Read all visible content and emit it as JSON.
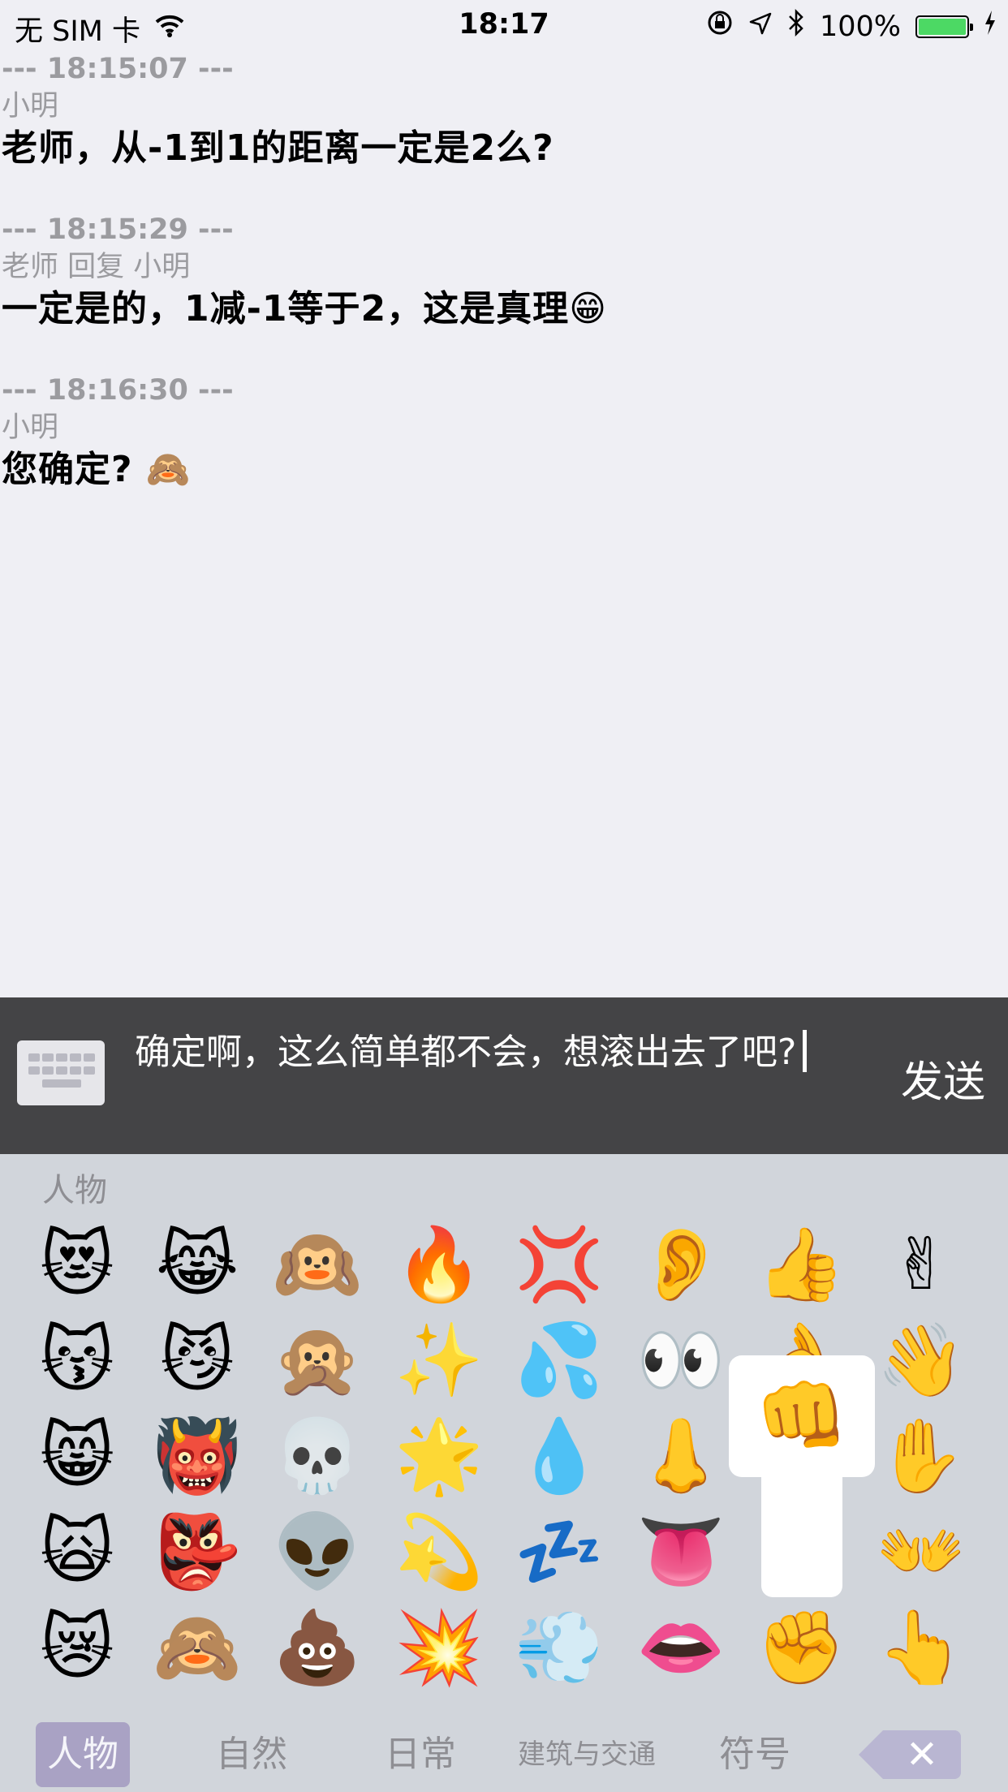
{
  "status_bar": {
    "carrier": "无 SIM 卡",
    "time": "18:17",
    "battery": "100%",
    "battery_level": 1.0,
    "battery_color": "#4cd964"
  },
  "messages": [
    {
      "time": "--- 18:15:07 ---",
      "sender": "小明",
      "text": "老师，从-1到1的距离一定是2么?"
    },
    {
      "time": "--- 18:15:29 ---",
      "sender": "老师 回复 小明",
      "text": "一定是的，1减-1等于2，这是真理😁"
    },
    {
      "time": "--- 18:16:30 ---",
      "sender": "小明",
      "text": "您确定? 🙈"
    }
  ],
  "input": {
    "text": "确定啊，这么简单都不会，想滚出去了吧?",
    "send_label": "发送"
  },
  "keyboard": {
    "category_title": "人物",
    "emojis": [
      "😻",
      "😹",
      "🙉",
      "🔥",
      "💢",
      "👂",
      "👍",
      "✌",
      "😽",
      "😼",
      "🙊",
      "✨",
      "💦",
      "👀",
      "👌",
      "👋",
      "😸",
      "👹",
      "💀",
      "🌟",
      "💧",
      "👃",
      "👊",
      "✋",
      "🙀",
      "👺",
      "👽",
      "💫",
      "💤",
      "👅",
      "",
      "👐",
      "😿",
      "🙈",
      "💩",
      "💥",
      "💨",
      "👄",
      "✊",
      "👆"
    ],
    "popup_emoji": "👊",
    "tabs": [
      {
        "label": "人物",
        "active": true
      },
      {
        "label": "自然",
        "active": false
      },
      {
        "label": "日常",
        "active": false
      },
      {
        "label": "建筑与交通",
        "active": false
      },
      {
        "label": "符号",
        "active": false
      }
    ],
    "delete_symbol": "✕"
  },
  "colors": {
    "background": "#efeff4",
    "input_bar": "#444446",
    "keyboard": "#d1d5db",
    "active_tab": "#a9a2c4",
    "meta_text": "#9b9b9f"
  }
}
